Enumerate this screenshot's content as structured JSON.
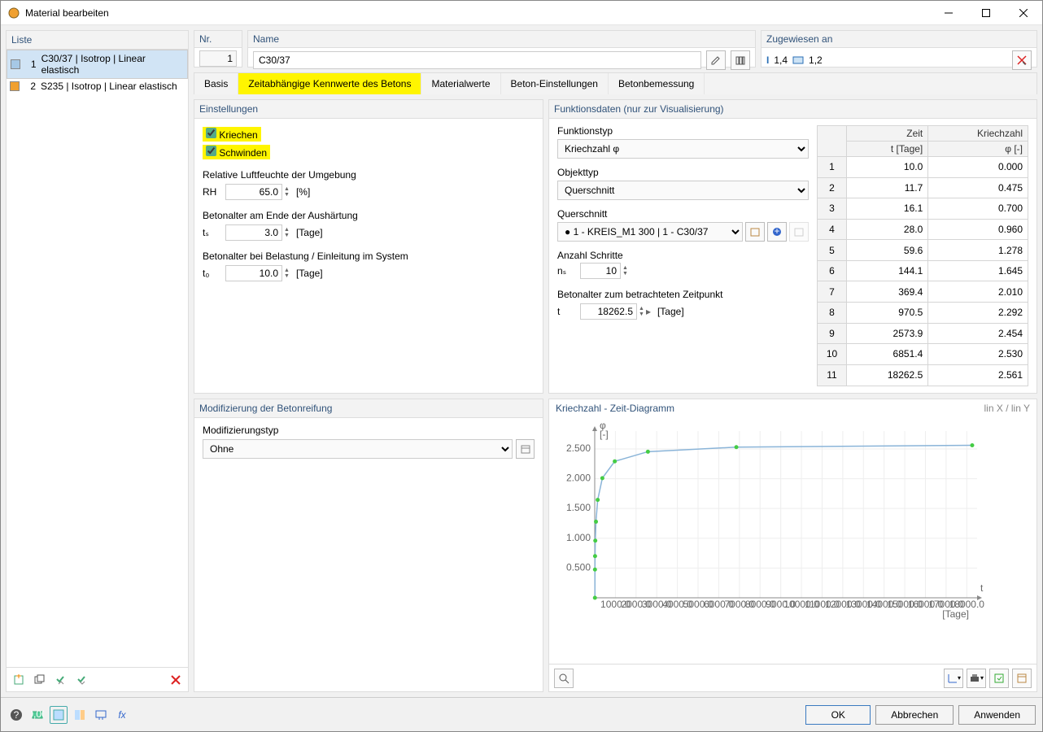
{
  "window": {
    "title": "Material bearbeiten"
  },
  "list": {
    "header": "Liste",
    "items": [
      {
        "num": "1",
        "label": "C30/37 | Isotrop | Linear elastisch",
        "color": "blue",
        "selected": true
      },
      {
        "num": "2",
        "label": "S235 | Isotrop | Linear elastisch",
        "color": "orange",
        "selected": false
      }
    ]
  },
  "nr": {
    "label": "Nr.",
    "value": "1"
  },
  "name": {
    "label": "Name",
    "value": "C30/37"
  },
  "assigned": {
    "label": "Zugewiesen an",
    "items": [
      "1,4",
      "1,2"
    ]
  },
  "tabs": [
    "Basis",
    "Zeitabhängige Kennwerte des Betons",
    "Materialwerte",
    "Beton-Einstellungen",
    "Betonbemessung"
  ],
  "active_tab": 1,
  "settings": {
    "header": "Einstellungen",
    "creep": "Kriechen",
    "shrink": "Schwinden",
    "rh_label": "Relative Luftfeuchte der Umgebung",
    "rh_sym": "RH",
    "rh_val": "65.0",
    "rh_unit": "[%]",
    "ts_label": "Betonalter am Ende der Aushärtung",
    "ts_sym": "tₛ",
    "ts_val": "3.0",
    "ts_unit": "[Tage]",
    "t0_label": "Betonalter bei Belastung / Einleitung im System",
    "t0_sym": "t₀",
    "t0_val": "10.0",
    "t0_unit": "[Tage]"
  },
  "mod": {
    "header": "Modifizierung der Betonreifung",
    "type_label": "Modifizierungstyp",
    "type_val": "Ohne"
  },
  "func": {
    "header": "Funktionsdaten (nur zur Visualisierung)",
    "ftype_label": "Funktionstyp",
    "ftype_val": "Kriechzahl φ",
    "otype_label": "Objekttyp",
    "otype_val": "Querschnitt",
    "cs_label": "Querschnitt",
    "cs_val": "1 - KREIS_M1 300 | 1 - C30/37",
    "steps_label": "Anzahl Schritte",
    "steps_sym": "nₛ",
    "steps_val": "10",
    "t_label": "Betonalter zum betrachteten Zeitpunkt",
    "t_sym": "t",
    "t_val": "18262.5",
    "t_unit": "[Tage]",
    "col_time": "Zeit",
    "col_time2": "t [Tage]",
    "col_phi": "Kriechzahl",
    "col_phi2": "φ [-]"
  },
  "table_rows": [
    [
      "1",
      "10.0",
      "0.000"
    ],
    [
      "2",
      "11.7",
      "0.475"
    ],
    [
      "3",
      "16.1",
      "0.700"
    ],
    [
      "4",
      "28.0",
      "0.960"
    ],
    [
      "5",
      "59.6",
      "1.278"
    ],
    [
      "6",
      "144.1",
      "1.645"
    ],
    [
      "7",
      "369.4",
      "2.010"
    ],
    [
      "8",
      "970.5",
      "2.292"
    ],
    [
      "9",
      "2573.9",
      "2.454"
    ],
    [
      "10",
      "6851.4",
      "2.530"
    ],
    [
      "11",
      "18262.5",
      "2.561"
    ]
  ],
  "chart": {
    "title": "Kriechzahl - Zeit-Diagramm",
    "axis_mode": "lin X / lin Y",
    "ylabel": "φ",
    "yunit": "[-]",
    "xlabel": "t",
    "xunit": "[Tage]",
    "yticks": [
      "0.500",
      "1.000",
      "1.500",
      "2.000",
      "2.500"
    ],
    "xticks": [
      "1000.0",
      "2000.0",
      "3000.0",
      "4000.0",
      "5000.0",
      "6000.0",
      "7000.0",
      "8000.0",
      "9000.0",
      "10000.0",
      "11000.0",
      "12000.0",
      "13000.0",
      "14000.0",
      "15000.0",
      "16000.0",
      "17000.0",
      "18000.0"
    ]
  },
  "chart_data": {
    "type": "line",
    "title": "Kriechzahl - Zeit-Diagramm",
    "xlabel": "t [Tage]",
    "ylabel": "φ [-]",
    "x": [
      10.0,
      11.7,
      16.1,
      28.0,
      59.6,
      144.1,
      369.4,
      970.5,
      2573.9,
      6851.4,
      18262.5
    ],
    "y": [
      0.0,
      0.475,
      0.7,
      0.96,
      1.278,
      1.645,
      2.01,
      2.292,
      2.454,
      2.53,
      2.561
    ],
    "xlim": [
      0,
      18500
    ],
    "ylim": [
      0,
      2.8
    ]
  },
  "buttons": {
    "ok": "OK",
    "cancel": "Abbrechen",
    "apply": "Anwenden"
  }
}
